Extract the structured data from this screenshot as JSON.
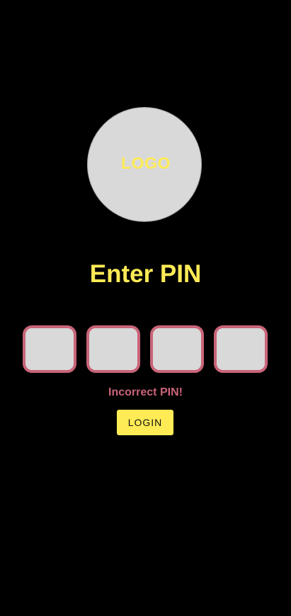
{
  "logo": {
    "text": "LOGO"
  },
  "title": "Enter PIN",
  "pin": {
    "fields": [
      {
        "value": ""
      },
      {
        "value": ""
      },
      {
        "value": ""
      },
      {
        "value": ""
      }
    ]
  },
  "error": "Incorrect PIN!",
  "login_button": {
    "label": "LOGIN"
  },
  "colors": {
    "background": "#000000",
    "accent": "#ffeb55",
    "error": "#c96478",
    "field_fill": "#d9d9d9"
  }
}
